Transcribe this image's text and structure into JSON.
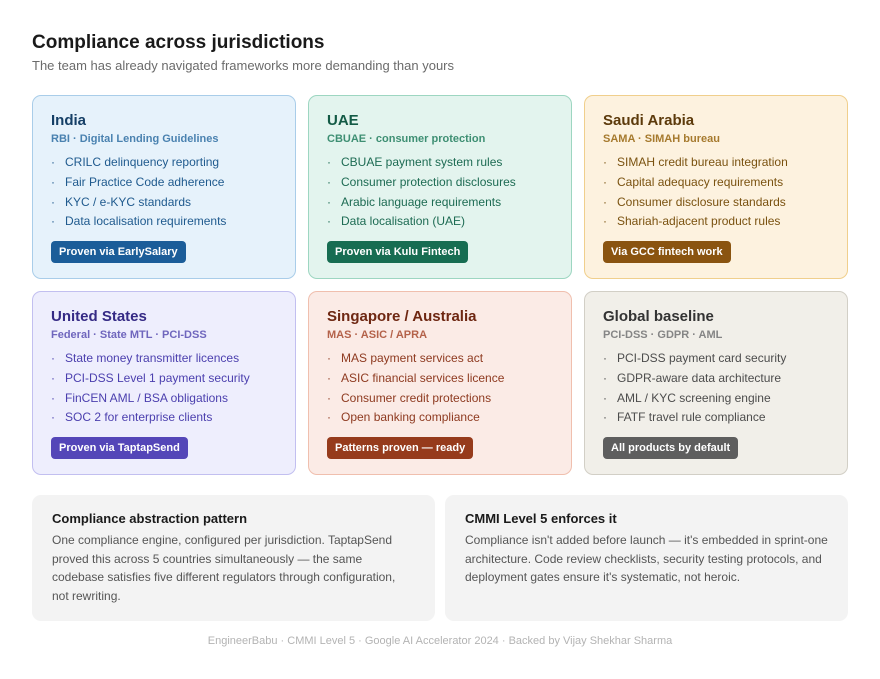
{
  "header": {
    "title": "Compliance across jurisdictions",
    "subtitle": "The team has already navigated frameworks more demanding than yours"
  },
  "cards": [
    {
      "title": "India",
      "subtitle": "RBI · Digital Lending Guidelines",
      "items": [
        "CRILC delinquency reporting",
        "Fair Practice Code adherence",
        "KYC / e-KYC standards",
        "Data localisation requirements"
      ],
      "badge": "Proven via EarlySalary",
      "colors": {
        "bg": "#e6f2fb",
        "border": "#a9cde9",
        "title": "#153f66",
        "sub": "#4a82b0",
        "text": "#1f5a8e",
        "badge": "#1b5d99"
      }
    },
    {
      "title": "UAE",
      "subtitle": "CBUAE · consumer protection",
      "items": [
        "CBUAE payment system rules",
        "Consumer protection disclosures",
        "Arabic language requirements",
        "Data localisation (UAE)"
      ],
      "badge": "Proven via Kulu Fintech",
      "colors": {
        "bg": "#e3f4ee",
        "border": "#9dd6c1",
        "title": "#135a45",
        "sub": "#3e8f73",
        "text": "#1d6b53",
        "badge": "#176d52"
      }
    },
    {
      "title": "Saudi Arabia",
      "subtitle": "SAMA · SIMAH bureau",
      "items": [
        "SIMAH credit bureau integration",
        "Capital adequacy requirements",
        "Consumer disclosure standards",
        "Shariah-adjacent product rules"
      ],
      "badge": "Via GCC fintech work",
      "colors": {
        "bg": "#fdf2df",
        "border": "#f0cf8c",
        "title": "#5c3a0b",
        "sub": "#a67a2e",
        "text": "#7a5210",
        "badge": "#8a5410"
      }
    },
    {
      "title": "United States",
      "subtitle": "Federal · State MTL · PCI-DSS",
      "items": [
        "State money transmitter licences",
        "PCI-DSS Level 1 payment security",
        "FinCEN AML / BSA obligations",
        "SOC 2 for enterprise clients"
      ],
      "badge": "Proven via TaptapSend",
      "colors": {
        "bg": "#eeeefd",
        "border": "#c2bff0",
        "title": "#352a85",
        "sub": "#6f66bd",
        "text": "#4b3fae",
        "badge": "#5446b8"
      }
    },
    {
      "title": "Singapore / Australia",
      "subtitle": "MAS · ASIC / APRA",
      "items": [
        "MAS payment services act",
        "ASIC financial services licence",
        "Consumer credit protections",
        "Open banking compliance"
      ],
      "badge": "Patterns proven — ready",
      "colors": {
        "bg": "#fbebe6",
        "border": "#f0bfae",
        "title": "#6e2712",
        "sub": "#b4624a",
        "text": "#8e3a20",
        "badge": "#963b1c"
      }
    },
    {
      "title": "Global baseline",
      "subtitle": "PCI-DSS · GDPR · AML",
      "items": [
        "PCI-DSS payment card security",
        "GDPR-aware data architecture",
        "AML / KYC screening engine",
        "FATF travel rule compliance"
      ],
      "badge": "All products by default",
      "colors": {
        "bg": "#f1efe9",
        "border": "#d2cfc6",
        "title": "#333333",
        "sub": "#858585",
        "text": "#4c4c4c",
        "badge": "#5e5e5e"
      }
    }
  ],
  "notes": [
    {
      "title": "Compliance abstraction pattern",
      "text": "One compliance engine, configured per jurisdiction. TaptapSend proved this across 5 countries simultaneously — the same codebase satisfies five different regulators through configuration, not rewriting."
    },
    {
      "title": "CMMI Level 5 enforces it",
      "text": "Compliance isn't added before launch — it's embedded in sprint-one architecture. Code review checklists, security testing protocols, and deployment gates ensure it's systematic, not heroic."
    }
  ],
  "footer": "EngineerBabu · CMMI Level 5 · Google AI Accelerator 2024 · Backed by Vijay Shekhar Sharma",
  "bullet_glyph": "·"
}
